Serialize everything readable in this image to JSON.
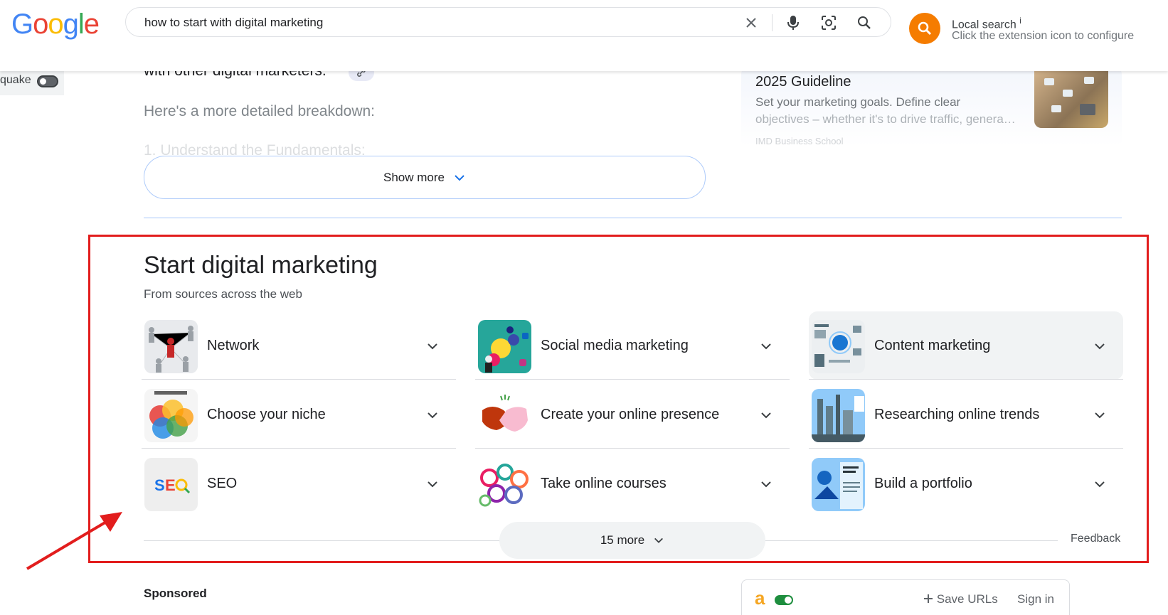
{
  "header": {
    "logo": [
      "G",
      "o",
      "o",
      "g",
      "l",
      "e"
    ],
    "logo_colors": [
      "#4285F4",
      "#EA4335",
      "#FBBC05",
      "#4285F4",
      "#34A853",
      "#EA4335"
    ],
    "search_query": "how to start with digital marketing",
    "extension": {
      "title": "Local search",
      "info_mark": "i",
      "subtitle": "Click the extension icon to configure",
      "color": "#f57c00"
    }
  },
  "side": {
    "quake_label": "quake"
  },
  "upper": {
    "line": "with other digital marketers.",
    "breakdown": "Here's a more detailed breakdown:",
    "faded_line": "1. Understand the Fundamentals:",
    "show_more": "Show more"
  },
  "right_card": {
    "title": "2025 Guideline",
    "desc1": "Set your marketing goals. Define clear",
    "desc2": "objectives – whether it's to drive traffic, genera…",
    "source": "IMD Business School"
  },
  "section": {
    "title": "Start digital marketing",
    "subtitle": "From sources across the web",
    "items": [
      {
        "label": "Network",
        "icon": "network-people-image"
      },
      {
        "label": "Social media marketing",
        "icon": "social-media-image"
      },
      {
        "label": "Content marketing",
        "icon": "content-infographic-image"
      },
      {
        "label": "Choose your niche",
        "icon": "niche-venn-image"
      },
      {
        "label": "Create your online presence",
        "icon": "handshake-image"
      },
      {
        "label": "Researching online trends",
        "icon": "industry-trends-image"
      },
      {
        "label": "SEO",
        "icon": "seo-logo-image"
      },
      {
        "label": "Take online courses",
        "icon": "courses-circles-image"
      },
      {
        "label": "Build a portfolio",
        "icon": "portfolio-image"
      }
    ],
    "more_button": "15 more",
    "feedback": "Feedback"
  },
  "bottom": {
    "sponsored": "Sponsored",
    "ext_letter": "a",
    "save_urls": "Save URLs",
    "sign_in": "Sign in"
  },
  "annotation_color": "#e21d1d"
}
